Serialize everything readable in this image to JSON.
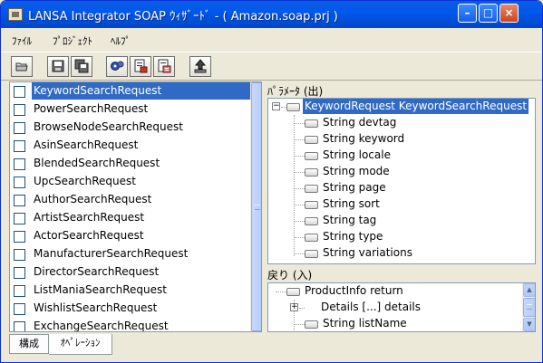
{
  "window": {
    "title": "LANSA Integrator SOAP ｳｨｻﾞｰﾄﾞ - ( Amazon.soap.prj )",
    "controls": {
      "minimize": "–",
      "maximize": "□",
      "close": "×"
    }
  },
  "menu": [
    "ﾌｧｲﾙ",
    "ﾌﾟﾛｼﾞｪｸﾄ",
    "ﾍﾙﾌﾟ"
  ],
  "toolbar": [
    "open-folder-icon",
    "save-icon",
    "save-all-icon",
    "settings-gear-icon",
    "document-properties-icon",
    "document-list-icon",
    "upload-icon"
  ],
  "request_list": {
    "selected_index": 0,
    "items": [
      "KeywordSearchRequest",
      "PowerSearchRequest",
      "BrowseNodeSearchRequest",
      "AsinSearchRequest",
      "BlendedSearchRequest",
      "UpcSearchRequest",
      "AuthorSearchRequest",
      "ArtistSearchRequest",
      "ActorSearchRequest",
      "ManufacturerSearchRequest",
      "DirectorSearchRequest",
      "ListManiaSearchRequest",
      "WishlistSearchRequest",
      "ExchangeSearchRequest"
    ]
  },
  "parameters": {
    "label": "ﾊﾟﾗﾒｰﾀ (出)",
    "root": "KeywordRequest KeywordSearchRequest",
    "children": [
      "String devtag",
      "String keyword",
      "String locale",
      "String mode",
      "String page",
      "String sort",
      "String tag",
      "String type",
      "String variations"
    ]
  },
  "returns": {
    "label": "戻り (入)",
    "root": "ProductInfo return",
    "children": [
      {
        "text": "Details [...] details",
        "expandable": true
      },
      {
        "text": "String listName",
        "expandable": false
      }
    ]
  },
  "tabs": [
    {
      "label": "構成",
      "active": false
    },
    {
      "label": "ｵﾍﾟﾚｰｼｮﾝ",
      "active": true
    }
  ]
}
